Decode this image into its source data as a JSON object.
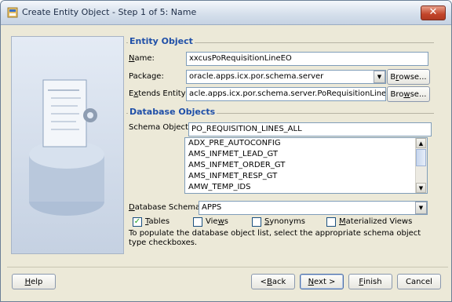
{
  "window": {
    "title": "Create Entity Object - Step 1 of 5: Name",
    "close_glyph": "✕"
  },
  "entity_object": {
    "heading": "Entity Object",
    "name_label": {
      "pre": "",
      "key": "N",
      "post": "ame:"
    },
    "name_value": "xxcusPoRequisitionLineEO",
    "package_label": {
      "pre": "Package:",
      "key": "",
      "post": ""
    },
    "package_value": "oracle.apps.icx.por.schema.server",
    "extends_label": {
      "pre": "E",
      "key": "x",
      "post": "tends Entity:"
    },
    "extends_value": "acle.apps.icx.por.schema.server.PoRequisitionLineEO",
    "browse_label": {
      "pre": "B",
      "key": "r",
      "post": "owse..."
    },
    "browse2_label": {
      "pre": "Bro",
      "key": "w",
      "post": "se..."
    }
  },
  "database_objects": {
    "heading": "Database Objects",
    "schema_object_label": "Schema Object:",
    "schema_object_value": "PO_REQUISITION_LINES_ALL",
    "list_items": [
      "ADX_PRE_AUTOCONFIG",
      "AMS_INFMET_LEAD_GT",
      "AMS_INFMET_ORDER_GT",
      "AMS_INFMET_RESP_GT",
      "AMW_TEMP_IDS"
    ],
    "db_schema_label": {
      "pre": "",
      "key": "D",
      "post": "atabase Schema:"
    },
    "db_schema_value": "APPS",
    "checkboxes": [
      {
        "pre": "",
        "key": "T",
        "post": "ables",
        "checked": true
      },
      {
        "pre": "Vie",
        "key": "w",
        "post": "s",
        "checked": false
      },
      {
        "pre": "",
        "key": "S",
        "post": "ynonyms",
        "checked": false
      },
      {
        "pre": "",
        "key": "M",
        "post": "aterialized Views",
        "checked": false
      }
    ],
    "help_text": "To populate the database object list, select the appropriate schema object type checkboxes."
  },
  "footer": {
    "help": {
      "pre": "",
      "key": "H",
      "post": "elp"
    },
    "back": {
      "pre": "< ",
      "key": "B",
      "post": "ack"
    },
    "next": {
      "pre": "",
      "key": "N",
      "post": "ext >"
    },
    "finish": {
      "pre": "",
      "key": "F",
      "post": "inish"
    },
    "cancel": {
      "pre": "Cancel",
      "key": "",
      "post": ""
    }
  },
  "colors": {
    "group_heading": "#1f4fa8",
    "checkmark": "#21a121",
    "close_button": "#c2452a"
  }
}
